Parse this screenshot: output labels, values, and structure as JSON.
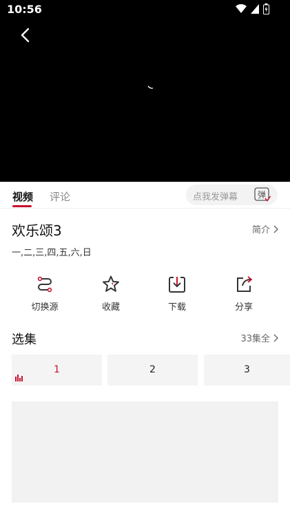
{
  "status_bar": {
    "time": "10:56"
  },
  "tabs": {
    "video": "视频",
    "comment": "评论"
  },
  "danmu": {
    "placeholder": "点我发弹幕",
    "button": "弹"
  },
  "show": {
    "title": "欢乐颂3",
    "intro_label": "简介",
    "days": "一,二,三,四,五,六,日"
  },
  "actions": [
    {
      "label": "切换源",
      "icon": "switch-source-icon"
    },
    {
      "label": "收藏",
      "icon": "star-icon"
    },
    {
      "label": "下载",
      "icon": "download-icon"
    },
    {
      "label": "分享",
      "icon": "share-icon"
    }
  ],
  "episodes_section": {
    "title": "选集",
    "count_label": "33集全",
    "episodes": [
      "1",
      "2",
      "3"
    ],
    "active": "1"
  },
  "colors": {
    "accent": "#c8102e",
    "player_bg": "#000000",
    "tile_bg": "#f4f4f4"
  }
}
